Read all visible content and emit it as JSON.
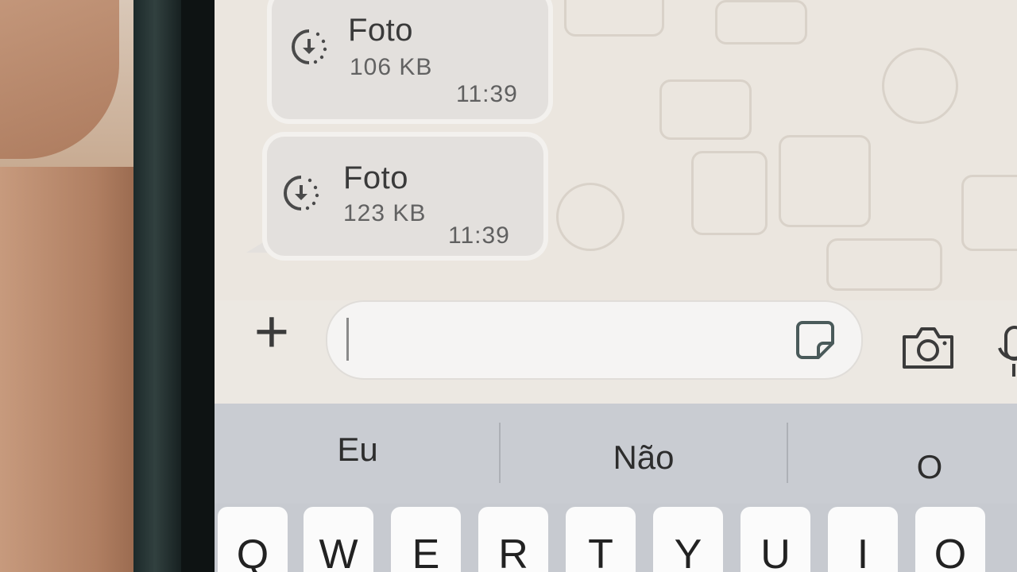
{
  "messages": [
    {
      "title": "Foto",
      "size": "106 KB",
      "time": "11:39",
      "icon": "download-pending-icon"
    },
    {
      "title": "Foto",
      "size": "123 KB",
      "time": "11:39",
      "icon": "download-pending-icon"
    }
  ],
  "composer": {
    "plus_label": "+",
    "field_value": "",
    "icons": [
      "plus-icon",
      "sticker-icon",
      "camera-icon",
      "microphone-icon"
    ]
  },
  "keyboard": {
    "suggestions": [
      "Eu",
      "Não",
      "O"
    ],
    "top_row_keys": [
      "Q",
      "W",
      "E",
      "R",
      "T",
      "Y",
      "U",
      "I",
      "O"
    ]
  },
  "colors": {
    "bubble": "#e3e0dd",
    "wallpaper": "#ebe6df",
    "keyboard": "#c7cad0"
  }
}
